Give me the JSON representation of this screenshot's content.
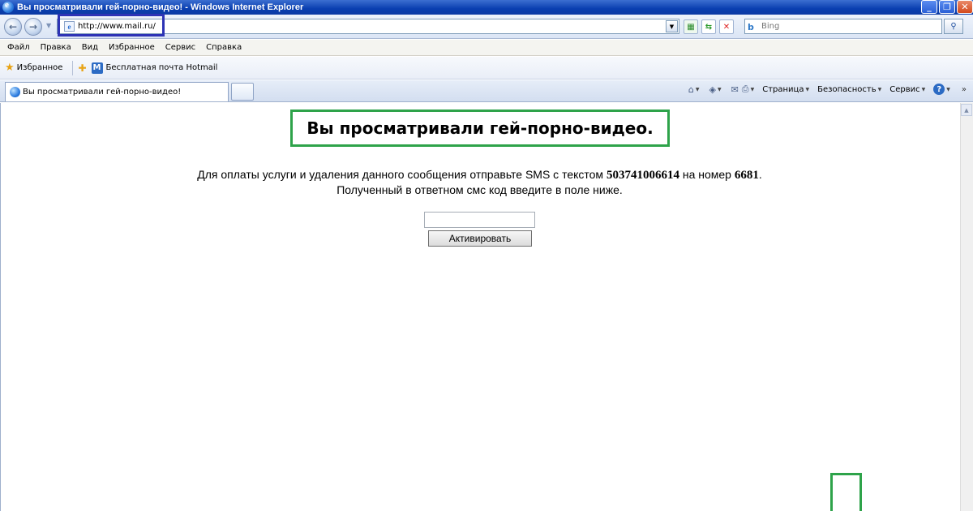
{
  "window": {
    "title": "Вы просматривали гей-порно-видео! - Windows Internet Explorer",
    "minimize_glyph": "_",
    "restore_glyph": "❐",
    "close_glyph": "✕"
  },
  "navbar": {
    "url": "http://www.mail.ru/",
    "search_placeholder": "Bing",
    "back_glyph": "←",
    "forward_glyph": "→"
  },
  "menu": [
    "Файл",
    "Правка",
    "Вид",
    "Избранное",
    "Сервис",
    "Справка"
  ],
  "favorites": {
    "label": "Избранное",
    "links": [
      "Бесплатная почта Hotmail"
    ]
  },
  "tab": {
    "title": "Вы просматривали гей-порно-видео!"
  },
  "commandbar": {
    "page": "Страница",
    "security": "Безопасность",
    "tools": "Сервис"
  },
  "page": {
    "headline": "Вы просматривали гей-порно-видео.",
    "line1_prefix": "Для оплаты услуги и удаления данного сообщения отправьте SMS с текстом ",
    "sms_text": "503741006614",
    "line1_middle": " на номер ",
    "sms_number": "6681",
    "line1_suffix": ".",
    "line2": "Полученный в ответном смс код введите в поле ниже.",
    "code_value": "",
    "button_label": "Активировать"
  },
  "colors": {
    "highlight_green": "#2ea34a",
    "highlight_blue": "#2d33b5",
    "titlebar_blue": "#0a3fb0"
  }
}
